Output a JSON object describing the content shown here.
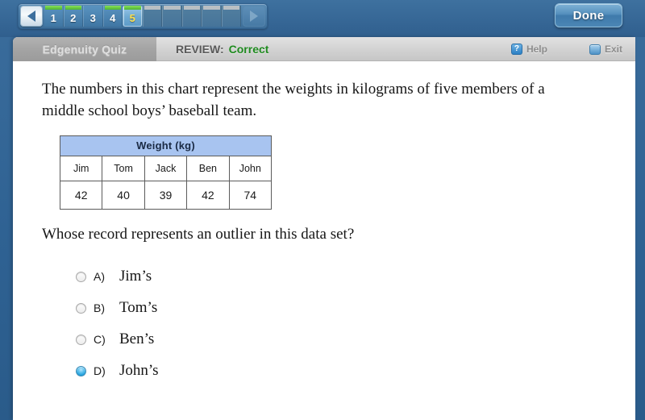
{
  "topbar": {
    "prev_icon": "triangle-left-icon",
    "next_icon": "triangle-right-icon",
    "items": [
      {
        "label": "1",
        "state": "ok",
        "current": false
      },
      {
        "label": "2",
        "state": "ok",
        "current": false
      },
      {
        "label": "3",
        "state": "no",
        "current": false
      },
      {
        "label": "4",
        "state": "ok",
        "current": false
      },
      {
        "label": "5",
        "state": "ok",
        "current": true
      },
      {
        "label": "",
        "state": "blank",
        "current": false
      },
      {
        "label": "",
        "state": "blank",
        "current": false
      },
      {
        "label": "",
        "state": "blank",
        "current": false
      },
      {
        "label": "",
        "state": "blank",
        "current": false
      },
      {
        "label": "",
        "state": "blank",
        "current": false
      }
    ],
    "done_label": "Done"
  },
  "header": {
    "brand": "Edgenuity Quiz",
    "review_label": "REVIEW:",
    "review_status": "Correct",
    "status_color": "#1f8a1f",
    "help_label": "Help",
    "help_icon": "question-mark-icon",
    "exit_label": "Exit",
    "exit_icon": "door-icon"
  },
  "question": {
    "stem": "The numbers in this chart represent the weights in kilograms of five members of a middle school boys’ baseball team.",
    "prompt": "Whose record represents an outlier in this data set?",
    "options": [
      {
        "letter": "A)",
        "text": "Jim’s",
        "selected": false
      },
      {
        "letter": "B)",
        "text": "Tom’s",
        "selected": false
      },
      {
        "letter": "C)",
        "text": "Ben’s",
        "selected": false
      },
      {
        "letter": "D)",
        "text": "John’s",
        "selected": true
      }
    ]
  },
  "chart_data": {
    "type": "table",
    "title": "Weight  (kg)",
    "header_bg": "#a8c4f0",
    "categories": [
      "Jim",
      "Tom",
      "Jack",
      "Ben",
      "John"
    ],
    "values": [
      42,
      40,
      39,
      42,
      74
    ],
    "xlabel": "",
    "ylabel": "Weight (kg)"
  }
}
